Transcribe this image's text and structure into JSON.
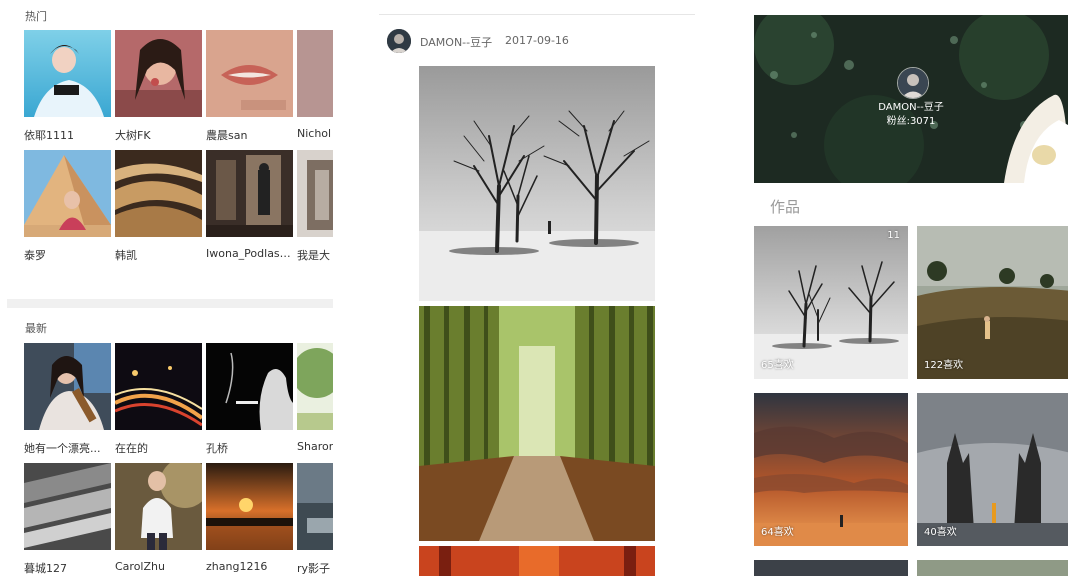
{
  "left": {
    "hot_label": "热门",
    "newest_label": "最新",
    "hot_rows": [
      [
        {
          "name": "依耶1111"
        },
        {
          "name": "大树FK"
        },
        {
          "name": "農晨san"
        },
        {
          "name": "Nichol"
        }
      ],
      [
        {
          "name": "泰罗"
        },
        {
          "name": "韩凯"
        },
        {
          "name": "Iwona_Podlasi..."
        },
        {
          "name": "我是大"
        }
      ]
    ],
    "newest_rows": [
      [
        {
          "name": "她有一个漂亮..."
        },
        {
          "name": "在在的"
        },
        {
          "name": "孔桥"
        },
        {
          "name": "Sharon"
        }
      ],
      [
        {
          "name": "暮城127"
        },
        {
          "name": "CarolZhu"
        },
        {
          "name": "zhang1216"
        },
        {
          "name": "ry影子"
        }
      ]
    ]
  },
  "post": {
    "author": "DAMON--豆子",
    "date": "2017-09-16"
  },
  "profile": {
    "name": "DAMON--豆子",
    "fans": "粉丝:3071",
    "works_title": "作品",
    "works": [
      {
        "likes": "65喜欢",
        "count": "11"
      },
      {
        "likes": "122喜欢",
        "count": ""
      },
      {
        "likes": "64喜欢",
        "count": ""
      },
      {
        "likes": "40喜欢",
        "count": ""
      }
    ]
  },
  "icons": {
    "avatar": "user-avatar-icon"
  }
}
